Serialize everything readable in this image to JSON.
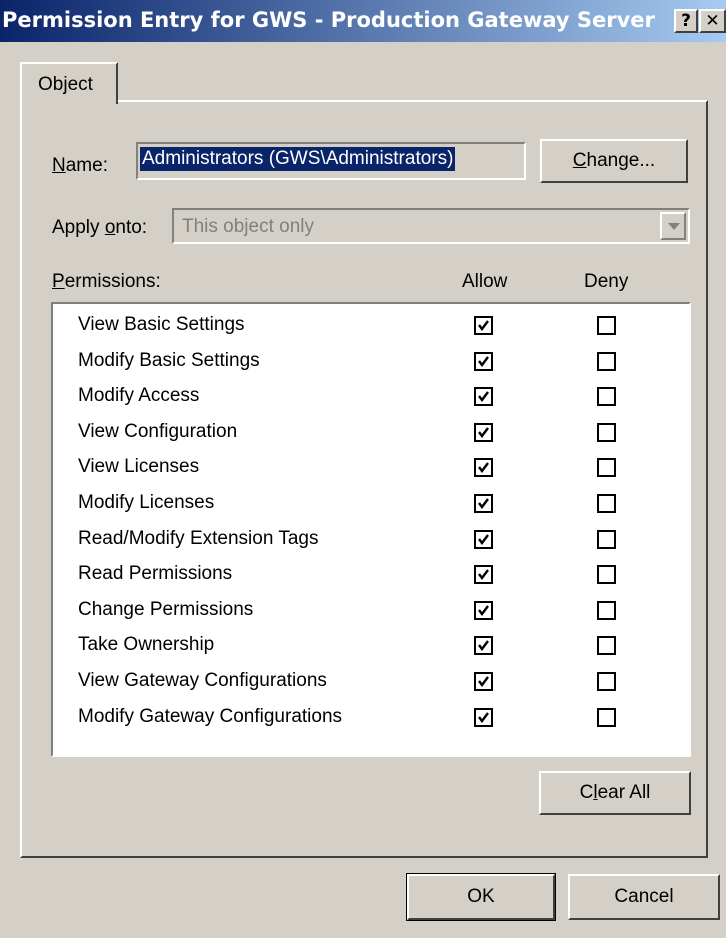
{
  "window": {
    "title": "Permission Entry for GWS - Production Gateway Server",
    "help_glyph": "?",
    "close_glyph": "✕"
  },
  "tab": {
    "label": "Object"
  },
  "name": {
    "label_accel": "N",
    "label_rest": "ame:",
    "value": "Administrators (GWS\\Administrators)"
  },
  "change_button": {
    "label_accel": "C",
    "label_rest": "hange..."
  },
  "apply_onto": {
    "label_pre": "Apply ",
    "label_accel": "o",
    "label_rest": "nto:",
    "value": "This object only"
  },
  "permissions": {
    "label_accel": "P",
    "label_rest": "ermissions:",
    "allow_header": "Allow",
    "deny_header": "Deny",
    "items": [
      {
        "label": "View Basic Settings",
        "allow": true,
        "deny": false
      },
      {
        "label": "Modify Basic Settings",
        "allow": true,
        "deny": false
      },
      {
        "label": "Modify Access",
        "allow": true,
        "deny": false
      },
      {
        "label": "View Configuration",
        "allow": true,
        "deny": false
      },
      {
        "label": "View Licenses",
        "allow": true,
        "deny": false
      },
      {
        "label": "Modify Licenses",
        "allow": true,
        "deny": false
      },
      {
        "label": "Read/Modify Extension Tags",
        "allow": true,
        "deny": false
      },
      {
        "label": "Read Permissions",
        "allow": true,
        "deny": false
      },
      {
        "label": "Change Permissions",
        "allow": true,
        "deny": false
      },
      {
        "label": "Take Ownership",
        "allow": true,
        "deny": false
      },
      {
        "label": "View Gateway Configurations",
        "allow": true,
        "deny": false
      },
      {
        "label": "Modify Gateway Configurations",
        "allow": true,
        "deny": false
      }
    ]
  },
  "clear_all_button": {
    "label_pre": "C",
    "label_accel": "l",
    "label_rest": "ear All"
  },
  "ok_button": {
    "label": "OK"
  },
  "cancel_button": {
    "label": "Cancel"
  },
  "colors": {
    "title_active": "#0a246a",
    "face": "#d4d0c8",
    "selection": "#0a246a"
  }
}
